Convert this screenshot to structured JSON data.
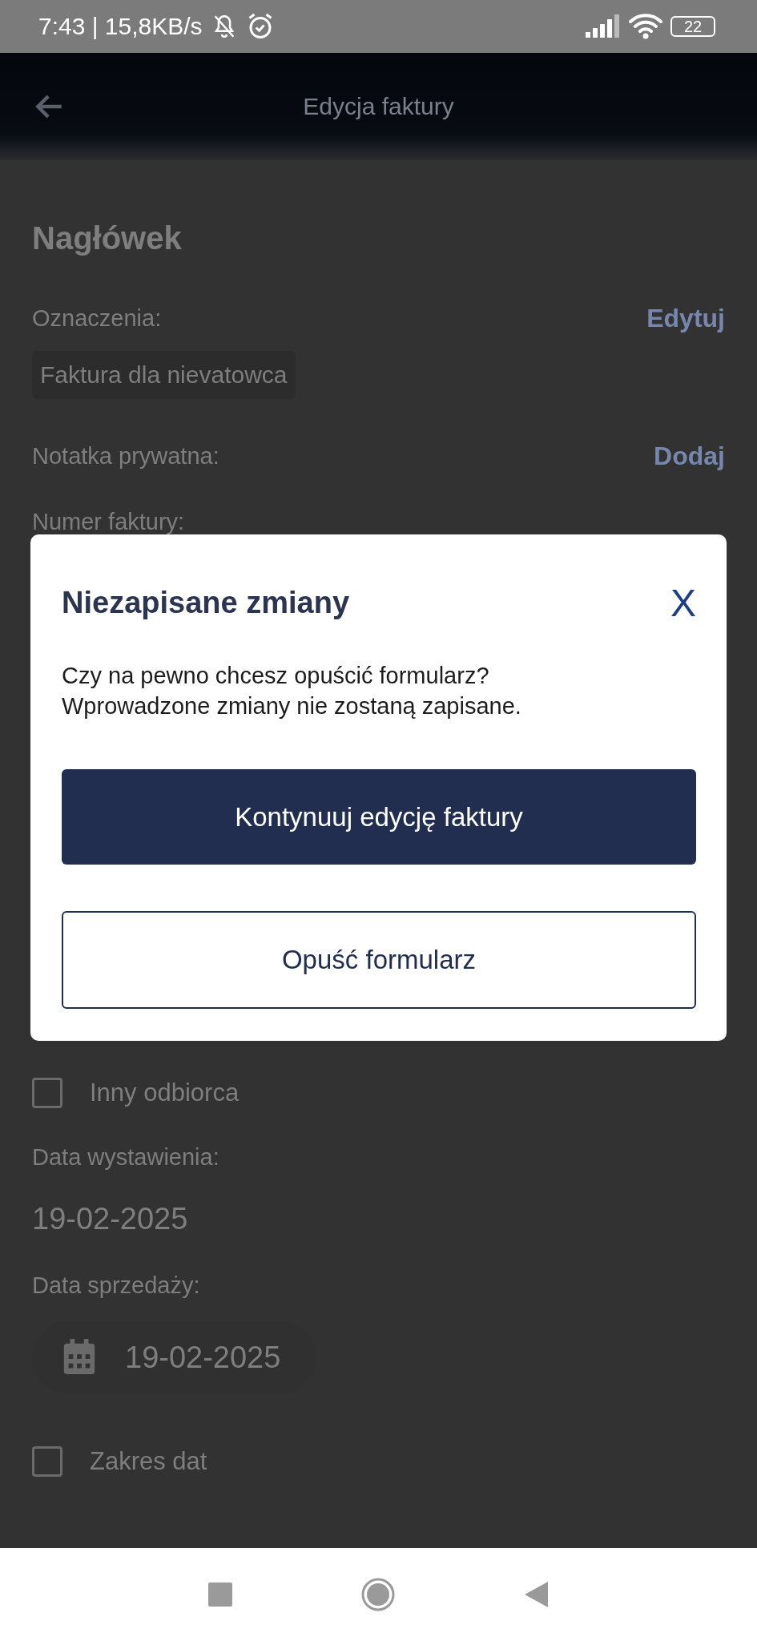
{
  "status_bar": {
    "time": "7:43 | 15,8KB/s",
    "battery": "22"
  },
  "app_bar": {
    "title": "Edycja faktury"
  },
  "form": {
    "top_items": [
      {
        "kind": "heading",
        "text": "Nagłówek"
      },
      {
        "kind": "label-action",
        "text": "Oznaczenia:",
        "action": "Edytuj"
      },
      {
        "kind": "chip",
        "text": "Faktura dla nievatowca"
      },
      {
        "kind": "label-action",
        "text": "Notatka prywatna:",
        "action": "Dodaj"
      },
      {
        "kind": "label",
        "text": "Numer faktury:"
      }
    ],
    "bottom_items": [
      {
        "kind": "checkbox",
        "text": "Inny odbiorca",
        "checked": false
      },
      {
        "kind": "label",
        "text": "Data wystawienia:"
      },
      {
        "kind": "date",
        "text": "19-02-2025"
      },
      {
        "kind": "label",
        "text": "Data sprzedaży:"
      },
      {
        "kind": "date-picker",
        "text": "19-02-2025"
      },
      {
        "kind": "checkbox",
        "text": "Zakres dat",
        "checked": false
      }
    ]
  },
  "dialog": {
    "title": "Niezapisane zmiany",
    "close": "X",
    "message": "Czy na pewno chcesz opuścić formularz?\nWprowadzone zmiany nie zostaną zapisane.",
    "buttons": [
      {
        "label": "Kontynuuj edycję faktury",
        "kind": "primary"
      },
      {
        "label": "Opuść formularz",
        "kind": "outline"
      }
    ]
  }
}
